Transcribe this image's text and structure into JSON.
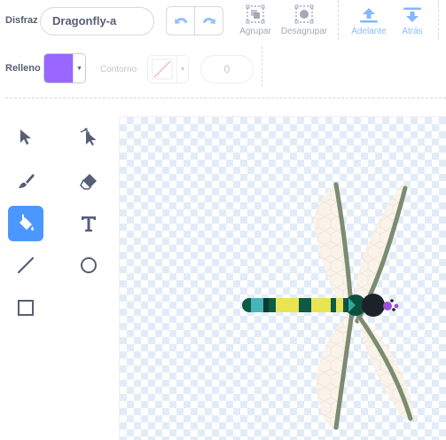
{
  "toolbar": {
    "costume_label": "Disfraz",
    "costume_name": "Dragonfly-a",
    "group_label": "Agrupar",
    "ungroup_label": "Desagrupar",
    "forward_label": "Adelante",
    "backward_label": "Atrás"
  },
  "style": {
    "fill_label": "Relleno",
    "fill_color": "#9966ff",
    "outline_label": "Contorno",
    "stroke_width": "0"
  },
  "tools": [
    "select",
    "reshape",
    "brush",
    "eraser",
    "fill",
    "text",
    "line",
    "circle",
    "rectangle"
  ],
  "selected_tool": "fill",
  "colors": {
    "accent": "#4c97ff",
    "text": "#575e75",
    "disabled": "#a4a9b6"
  }
}
